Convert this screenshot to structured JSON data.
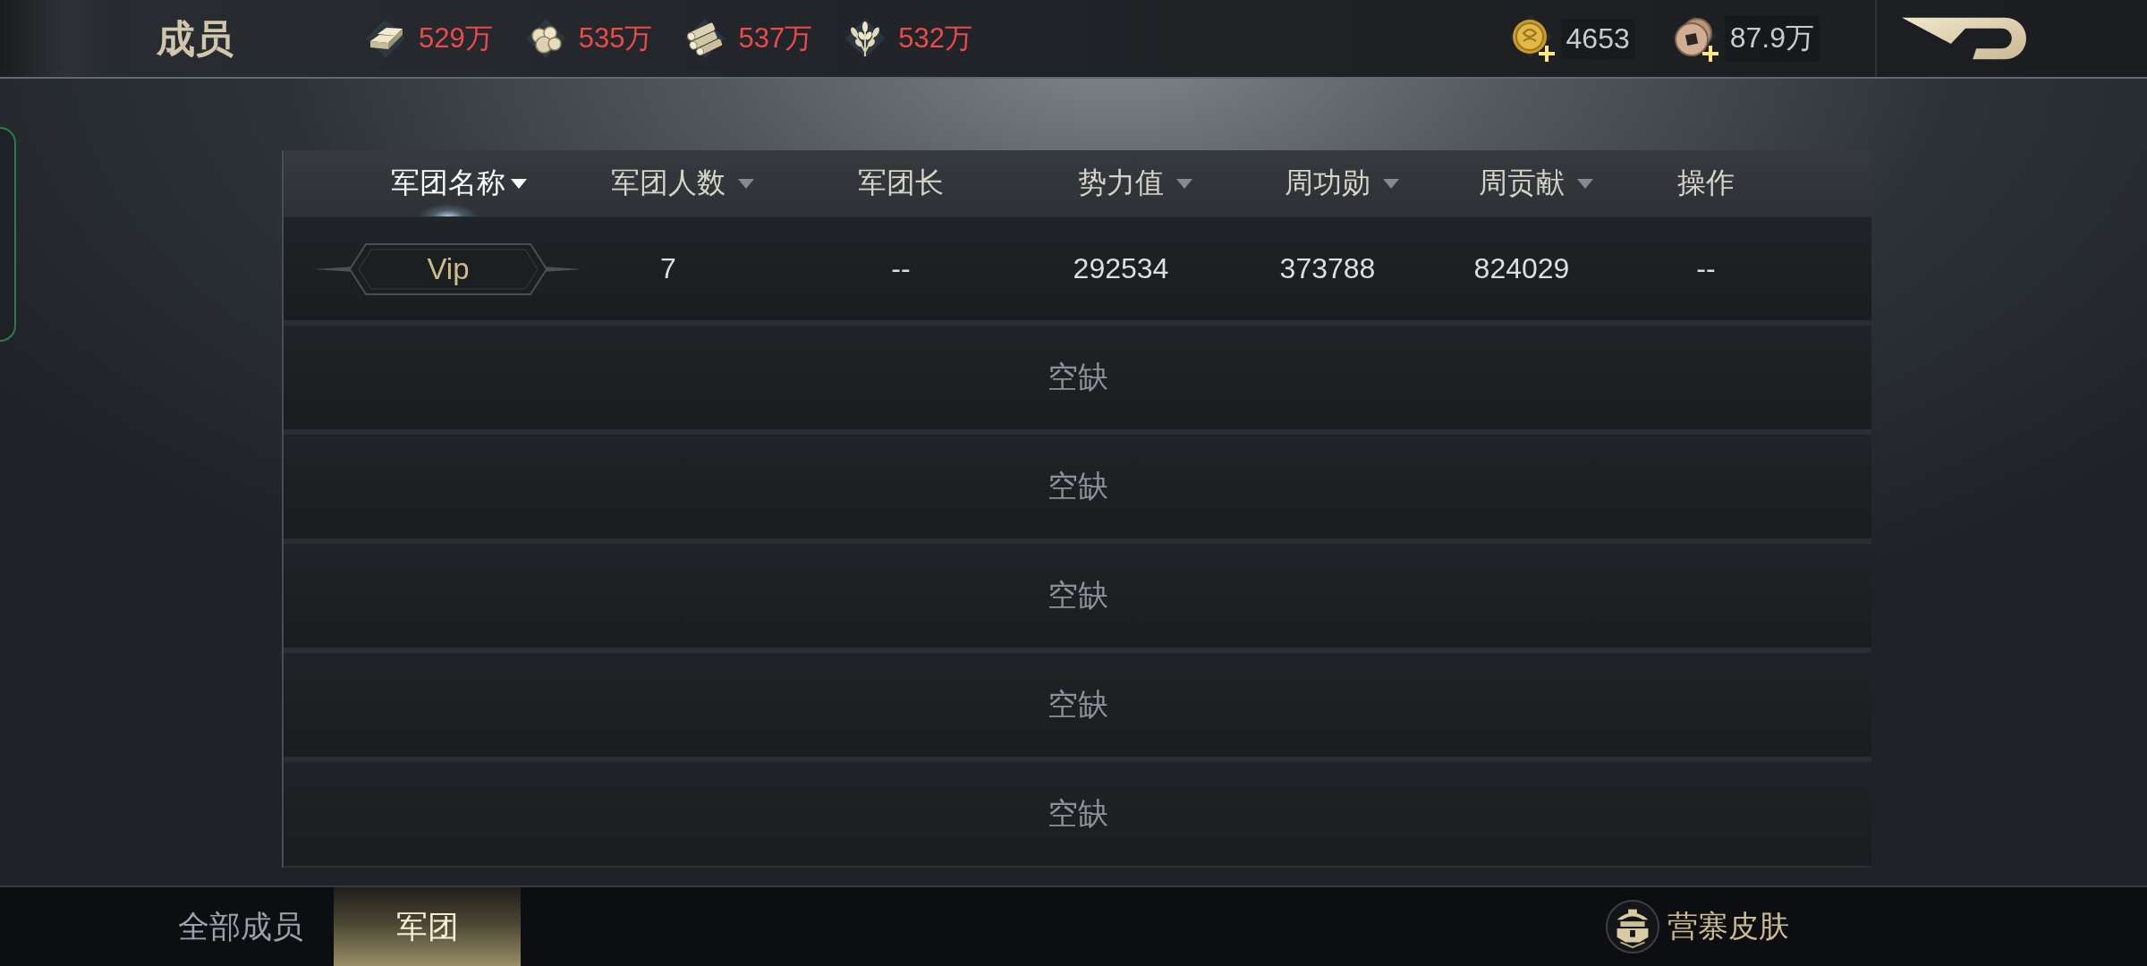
{
  "header": {
    "title": "成员",
    "resources": [
      {
        "kind": "ingot",
        "amount": "529万"
      },
      {
        "kind": "stone",
        "amount": "535万"
      },
      {
        "kind": "wood",
        "amount": "537万"
      },
      {
        "kind": "grain",
        "amount": "532万"
      }
    ],
    "currencies": [
      {
        "kind": "gold_coin",
        "amount": "4653"
      },
      {
        "kind": "copper_coin",
        "amount": "87.9万"
      }
    ]
  },
  "table": {
    "columns": [
      {
        "label": "军团名称",
        "sortable": true,
        "selected": true
      },
      {
        "label": "军团人数",
        "sortable": true,
        "selected": false
      },
      {
        "label": "军团长",
        "sortable": false,
        "selected": false
      },
      {
        "label": "势力值",
        "sortable": true,
        "selected": false
      },
      {
        "label": "周功勋",
        "sortable": true,
        "selected": false
      },
      {
        "label": "周贡献",
        "sortable": true,
        "selected": false
      },
      {
        "label": "操作",
        "sortable": false,
        "selected": false
      }
    ],
    "rows": [
      {
        "kind": "legion",
        "cells": [
          "Vip",
          "7",
          "--",
          "292534",
          "373788",
          "824029",
          "--"
        ]
      },
      {
        "kind": "vacant",
        "label": "空缺"
      },
      {
        "kind": "vacant",
        "label": "空缺"
      },
      {
        "kind": "vacant",
        "label": "空缺"
      },
      {
        "kind": "vacant",
        "label": "空缺"
      },
      {
        "kind": "vacant",
        "label": "空缺"
      }
    ]
  },
  "tabs": [
    {
      "label": "全部成员",
      "selected": false
    },
    {
      "label": "军团",
      "selected": true
    }
  ],
  "skin_button": {
    "label": "营寨皮肤"
  }
}
